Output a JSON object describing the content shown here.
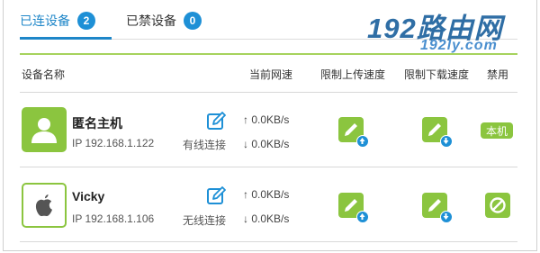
{
  "tabs": [
    {
      "label": "已连设备",
      "count": "2"
    },
    {
      "label": "已禁设备",
      "count": "0"
    }
  ],
  "logo": {
    "main": "192路由网",
    "sub": "192ly.com"
  },
  "table": {
    "headers": {
      "device": "设备名称",
      "rate": "当前网速",
      "upload_limit": "限制上传速度",
      "download_limit": "限制下载速度",
      "ban": "禁用"
    }
  },
  "devices": [
    {
      "name": "匿名主机",
      "ip": "IP 192.168.1.122",
      "conn": "有线连接",
      "up": "↑ 0.0KB/s",
      "down": "↓ 0.0KB/s",
      "ban_label": "本机"
    },
    {
      "name": "Vicky",
      "ip": "IP 192.168.1.106",
      "conn": "无线连接",
      "up": "↑ 0.0KB/s",
      "down": "↓ 0.0KB/s"
    }
  ],
  "colors": {
    "accent_blue": "#1e86c8",
    "accent_green": "#8bc53f",
    "logo_blue": "#2f6ea5"
  }
}
